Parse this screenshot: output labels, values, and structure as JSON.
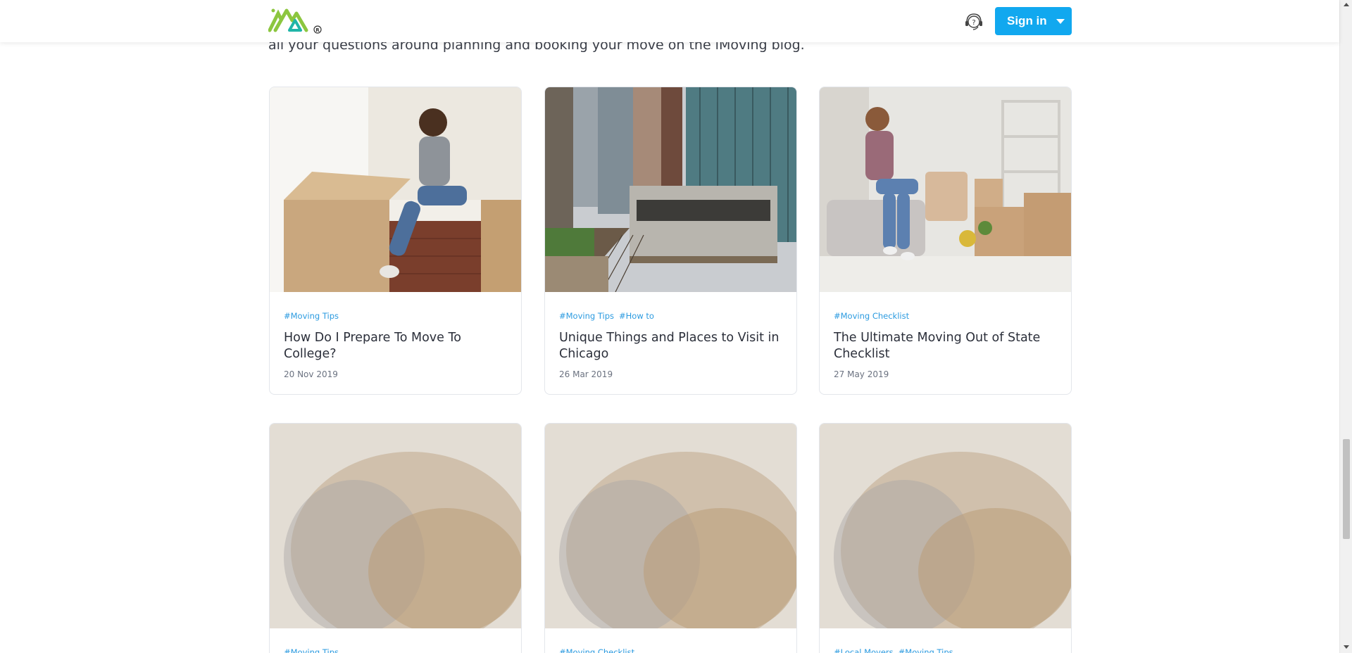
{
  "header": {
    "logo_name": "iMoving logo",
    "help_label": "?",
    "signin_label": "Sign in"
  },
  "intro": {
    "text": "all your questions around planning and booking your move on the iMoving blog."
  },
  "colors": {
    "accent": "#11a8ef",
    "tag": "#2c9be0",
    "logo_green": "#8cc63f",
    "logo_teal": "#1fb5a8"
  },
  "cards": [
    {
      "tags": [
        "#Moving Tips"
      ],
      "title": "How Do I Prepare To Move To College?",
      "date": "20 Nov 2019",
      "image": "woman-moving-boxes-photo"
    },
    {
      "tags": [
        "#Moving Tips",
        "#How to"
      ],
      "title": "Unique Things and Places to Visit in Chicago",
      "date": "26 Mar 2019",
      "image": "chicago-train-photo"
    },
    {
      "tags": [
        "#Moving Checklist"
      ],
      "title": "The Ultimate Moving Out of State Checklist",
      "date": "27 May 2019",
      "image": "woman-checklist-photo"
    },
    {
      "tags": [
        "#Moving Tips"
      ],
      "title": "",
      "date": "",
      "image": "blurred-photo"
    },
    {
      "tags": [
        "#Moving Checklist"
      ],
      "title": "",
      "date": "",
      "image": "blurred-photo"
    },
    {
      "tags": [
        "#Local Movers",
        "#Moving Tips"
      ],
      "title": "",
      "date": "",
      "image": "blurred-photo"
    }
  ]
}
